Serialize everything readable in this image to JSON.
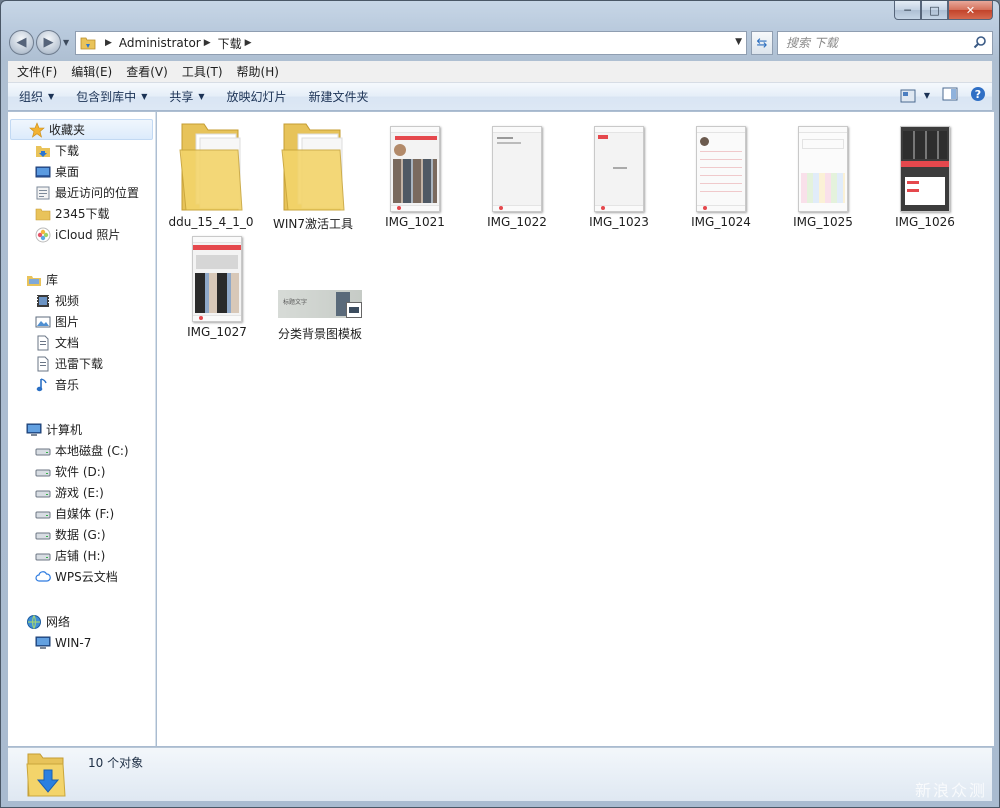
{
  "window": {
    "caption_buttons": {
      "minimize": "─",
      "maximize": "□",
      "close": "✕"
    }
  },
  "address_bar": {
    "path": [
      "Administrator",
      "下载"
    ],
    "search_placeholder": "搜索 下载"
  },
  "menu": [
    "文件(F)",
    "编辑(E)",
    "查看(V)",
    "工具(T)",
    "帮助(H)"
  ],
  "toolbar": {
    "organize": "组织",
    "include_in_library": "包含到库中",
    "share": "共享",
    "slideshow": "放映幻灯片",
    "new_folder": "新建文件夹"
  },
  "navigation": {
    "favorites": {
      "label": "收藏夹",
      "items": [
        "下载",
        "桌面",
        "最近访问的位置",
        "2345下载",
        "iCloud 照片"
      ]
    },
    "libraries": {
      "label": "库",
      "items": [
        "视频",
        "图片",
        "文档",
        "迅雷下载",
        "音乐"
      ]
    },
    "computer": {
      "label": "计算机",
      "items": [
        "本地磁盘 (C:)",
        "软件 (D:)",
        "游戏 (E:)",
        "自媒体 (F:)",
        "数据 (G:)",
        "店铺 (H:)",
        "WPS云文档"
      ]
    },
    "network": {
      "label": "网络",
      "items": [
        "WIN-7"
      ]
    }
  },
  "files": [
    {
      "name": "ddu_15_4_1_0",
      "type": "folder"
    },
    {
      "name": "WIN7激活工具",
      "type": "folder"
    },
    {
      "name": "IMG_1021",
      "type": "image"
    },
    {
      "name": "IMG_1022",
      "type": "image"
    },
    {
      "name": "IMG_1023",
      "type": "image"
    },
    {
      "name": "IMG_1024",
      "type": "image"
    },
    {
      "name": "IMG_1025",
      "type": "image"
    },
    {
      "name": "IMG_1026",
      "type": "image"
    },
    {
      "name": "IMG_1027",
      "type": "image"
    },
    {
      "name": "分类背景图模板",
      "type": "image",
      "thumb_text": "标题文字"
    }
  ],
  "status": {
    "count": "10 个对象"
  },
  "watermark": "新浪众测",
  "colors": {
    "accent_red": "#e5484d",
    "folder": "#f3d46a",
    "link_blue": "#1b3255"
  }
}
